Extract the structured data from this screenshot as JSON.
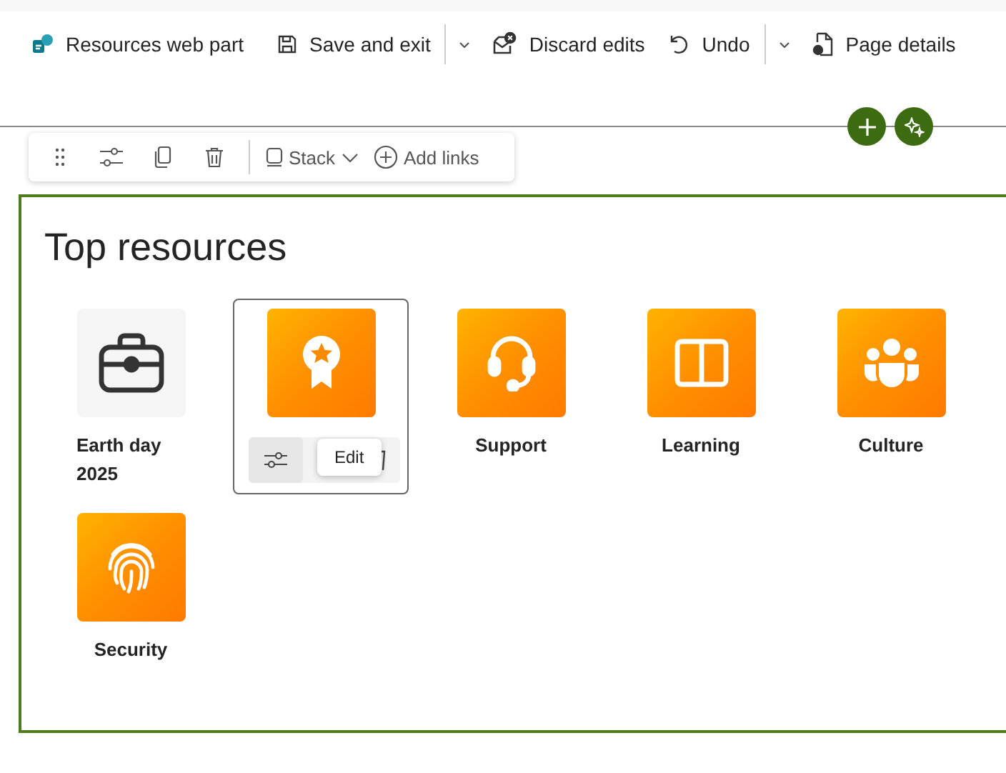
{
  "command_bar": {
    "title": "Resources web part",
    "save": "Save and exit",
    "discard": "Discard edits",
    "undo": "Undo",
    "page_details": "Page details"
  },
  "web_part_toolbar": {
    "layout": "Stack",
    "add_links": "Add links"
  },
  "web_part": {
    "title": "Top resources",
    "selected": true,
    "links": [
      {
        "label": "Earth day 2025",
        "kind": "plain",
        "selected": false
      },
      {
        "kind": "accent",
        "selected": true
      },
      {
        "label": "Support",
        "kind": "accent",
        "selected": false
      },
      {
        "label": "Learning",
        "kind": "accent",
        "selected": false
      },
      {
        "label": "Culture",
        "kind": "accent",
        "selected": false
      },
      {
        "label": "Security",
        "kind": "accent",
        "selected": false
      }
    ],
    "tooltip": "Edit"
  }
}
